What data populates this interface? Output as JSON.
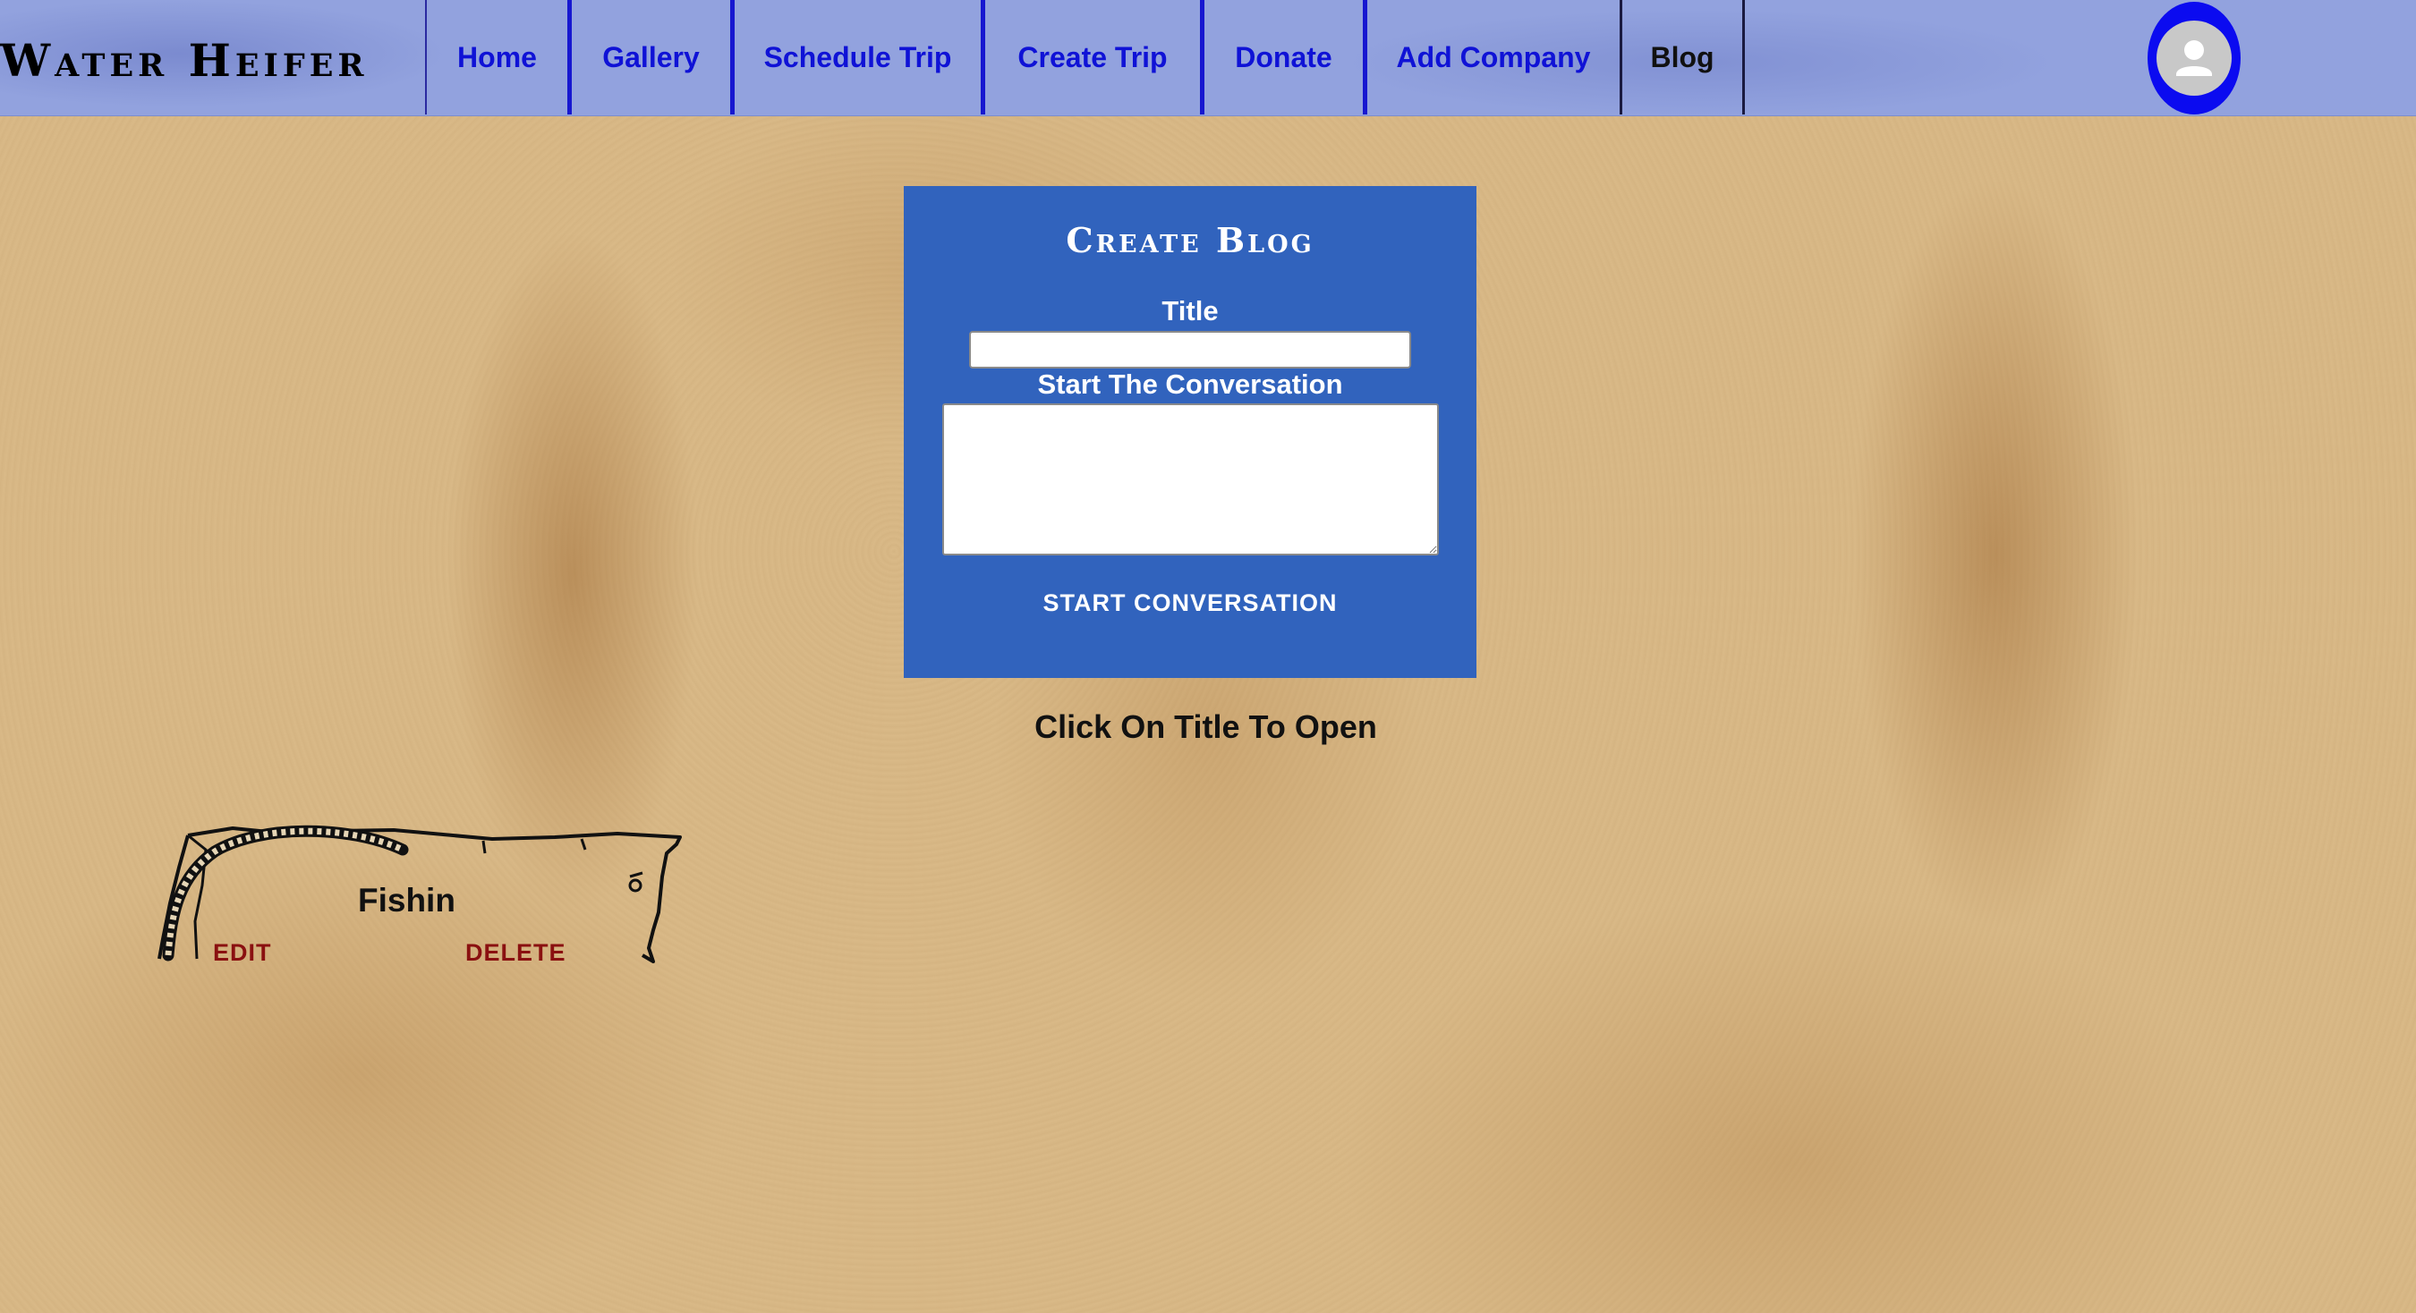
{
  "brand": "Water Heifer",
  "nav": {
    "items": [
      {
        "label": "Home"
      },
      {
        "label": "Gallery"
      },
      {
        "label": "Schedule Trip"
      },
      {
        "label": "Create Trip"
      },
      {
        "label": "Donate"
      },
      {
        "label": "Add Company"
      },
      {
        "label": "Blog",
        "active": true
      }
    ],
    "profile_icon": "user-avatar-icon"
  },
  "create_blog": {
    "heading": "Create Blog",
    "title_label": "Title",
    "title_value": "",
    "conversation_label": "Start The Conversation",
    "conversation_value": "",
    "submit_label": "START CONVERSATION"
  },
  "hint": "Click On Title To Open",
  "posts": [
    {
      "title": "Fishin",
      "edit_label": "EDIT",
      "delete_label": "DELETE"
    }
  ],
  "colors": {
    "nav_background": "#92a2de",
    "nav_link": "#0f12d6",
    "card_background": "#3163bd",
    "page_background": "#d9b987",
    "action_link": "#8a1010",
    "avatar_ring": "#0b0bf0"
  }
}
